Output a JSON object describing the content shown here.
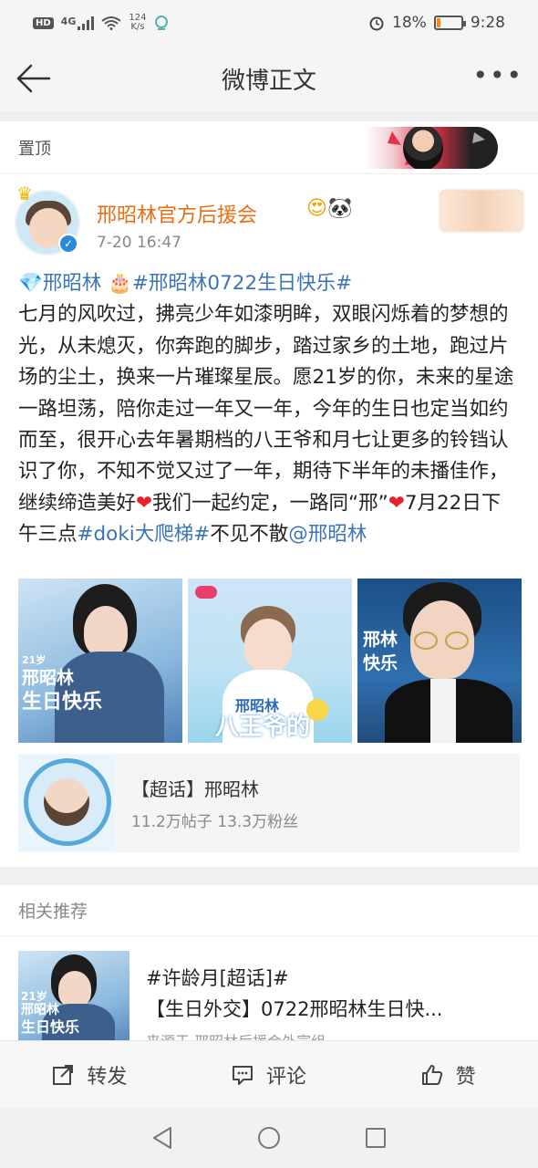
{
  "status_bar": {
    "hd_label": "HD",
    "network": "4G",
    "speed_value": "124",
    "speed_unit": "K/s",
    "battery": "18%",
    "battery_level": 0.18,
    "time": "9:28"
  },
  "nav": {
    "title": "微博正文"
  },
  "pinned": {
    "label": "置顶"
  },
  "author": {
    "name": "邢昭林官方后援会",
    "time": "7-20 16:47"
  },
  "post": {
    "topic_name": "邢昭林",
    "birthday_tag": "#邢昭林0722生日快乐#",
    "body_1": "七月的风吹过，拂亮少年如漆明眸，双眼闪烁着的梦想的光，从未熄灭，你奔跑的脚步，踏过家乡的土地，跑过片场的尘土，换来一片璀璨星辰。愿21岁的你，未来的星途一路坦荡，陪你走过一年又一年，今年的生日也定当如约而至，很开心去年暑期档的八王爷和月七让更多的铃铛认识了你，不知不觉又过了一年，期待下半年的未播佳作，继续缔造美好",
    "body_2": "我们一起约定，一路同“邢”",
    "body_3": "7月22日下午三点",
    "doki_tag": "#doki大爬梯#",
    "body_4": "不见不散",
    "mention": "@邢昭林"
  },
  "images": {
    "img1_text_age": "21岁",
    "img1_text_name": "邢昭林",
    "img1_text_bday": "生日快乐",
    "img2_text_name": "邢昭林",
    "img2_text_role": "八王爷的",
    "img3_text_name": "邢林",
    "img3_text_bday": "快乐"
  },
  "super_topic": {
    "title": "【超话】邢昭林",
    "stats": "11.2万帖子 13.3万粉丝"
  },
  "related": {
    "heading": "相关推荐",
    "item_line1": "#许龄月[超话]#",
    "item_line2": "【生日外交】0722邢昭林生日快...",
    "item_source": "来源于 邢昭林后援会外宣组"
  },
  "actions": {
    "repost": "转发",
    "comment": "评论",
    "like": "赞"
  },
  "colors": {
    "link": "#3a74b7",
    "author_name": "#e96d13",
    "heart": "#e8202b"
  }
}
